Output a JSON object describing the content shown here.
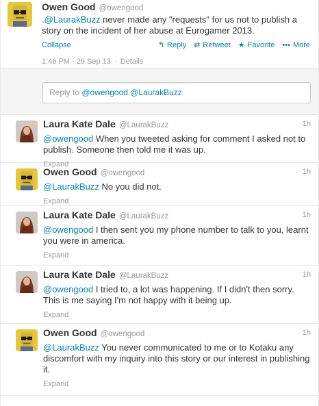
{
  "main": {
    "fullname": "Owen Good",
    "screen": "@owengood",
    "text_prefix": ".",
    "mention": "@LaurakBuzz",
    "text_rest": " never made any \"requests\" for us not to publish a story on the incident of her abuse at Eurogamer 2013.",
    "collapse": "Collapse",
    "actions": {
      "reply": "Reply",
      "retweet": "Retweet",
      "favorite": "Favorite",
      "more": "More"
    },
    "time": "1:46 PM - 29 Sep 13",
    "separator": "·",
    "details": "Details"
  },
  "reply_box": {
    "prefix": "Reply to ",
    "mentions": "@owengood @LaurakBuzz"
  },
  "replies": [
    {
      "fullname": "Laura Kate Dale",
      "screen": "@LaurakBuzz",
      "time": "1h",
      "mention": "@owengood",
      "text": " When you tweeted asking for comment I asked not to publish. Someone then told me it was up.",
      "expand": "Expand"
    },
    {
      "fullname": "Owen Good",
      "screen": "@owengood",
      "time": "1h",
      "mention": "@LaurakBuzz",
      "text": " No you did not.",
      "expand": "Expand"
    },
    {
      "fullname": "Laura Kate Dale",
      "screen": "@LaurakBuzz",
      "time": "1h",
      "mention": "@owengood",
      "text": " I then sent you my phone number to talk to you, learnt you were in america.",
      "expand": "Expand"
    },
    {
      "fullname": "Laura Kate Dale",
      "screen": "@LaurakBuzz",
      "time": "1h",
      "mention": "@owengood",
      "text": " I tried to, a lot was happening. If I didn't then sorry. This is me saying I'm not happy with it being up.",
      "expand": "Expand"
    },
    {
      "fullname": "Owen Good",
      "screen": "@owengood",
      "time": "1h",
      "mention": "@LaurakBuzz",
      "text": " You never communicated to me or to Kotaku any discomfort with my inquiry into this story or our interest in publishing it.",
      "expand": "Expand"
    }
  ],
  "colors": {
    "link": "#0084b4",
    "muted": "#999999",
    "text": "#333333"
  }
}
